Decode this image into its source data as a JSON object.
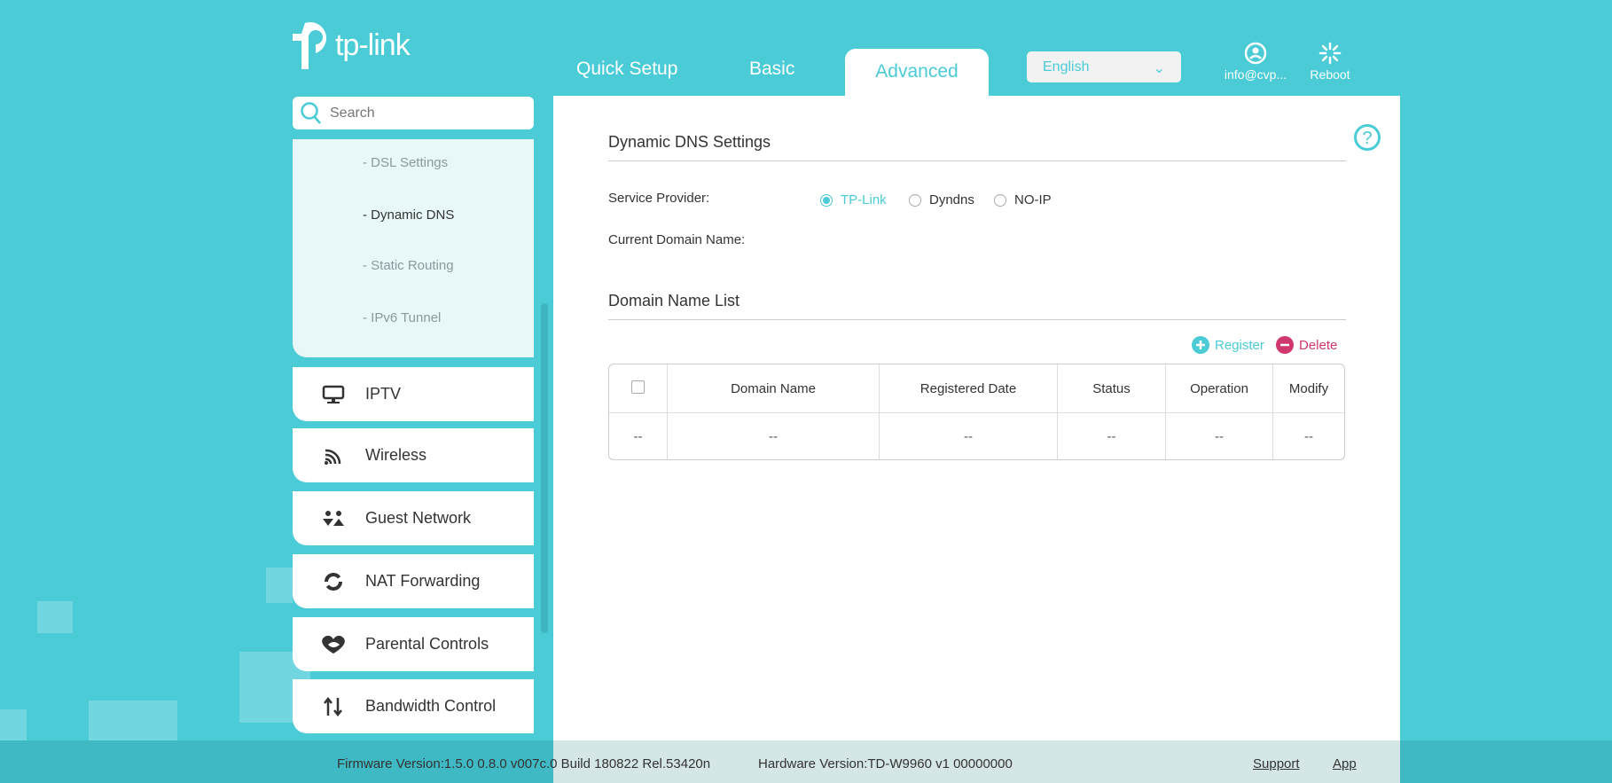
{
  "brand": {
    "logo_text": "tp-link"
  },
  "tabs": [
    {
      "label": "Quick Setup"
    },
    {
      "label": "Basic"
    },
    {
      "label": "Advanced"
    }
  ],
  "language": {
    "selected": "English"
  },
  "account": {
    "label": "info@cvp..."
  },
  "reboot": {
    "label": "Reboot"
  },
  "search": {
    "placeholder": "Search"
  },
  "submenu": [
    {
      "label": "- DSL Settings"
    },
    {
      "label": "- Dynamic DNS"
    },
    {
      "label": "- Static Routing"
    },
    {
      "label": "- IPv6 Tunnel"
    }
  ],
  "sidebar": [
    {
      "label": "IPTV",
      "icon": "monitor-icon"
    },
    {
      "label": "Wireless",
      "icon": "wireless-icon"
    },
    {
      "label": "Guest Network",
      "icon": "guest-icon"
    },
    {
      "label": "NAT Forwarding",
      "icon": "nat-icon"
    },
    {
      "label": "Parental Controls",
      "icon": "heart-icon"
    },
    {
      "label": "Bandwidth Control",
      "icon": "updown-icon"
    }
  ],
  "ddns": {
    "title": "Dynamic DNS Settings",
    "service_provider_label": "Service Provider:",
    "providers": [
      {
        "label": "TP-Link",
        "selected": true
      },
      {
        "label": "Dyndns",
        "selected": false
      },
      {
        "label": "NO-IP",
        "selected": false
      }
    ],
    "current_domain_label": "Current Domain Name:",
    "list_title": "Domain Name List",
    "register_label": "Register",
    "delete_label": "Delete",
    "columns": [
      "Domain Name",
      "Registered Date",
      "Status",
      "Operation",
      "Modify"
    ],
    "rows": [
      [
        "--",
        "--",
        "--",
        "--",
        "--",
        "--"
      ]
    ]
  },
  "footer": {
    "firmware": "Firmware Version:1.5.0 0.8.0 v007c.0 Build 180822 Rel.53420n",
    "hardware": "Hardware Version:TD-W9960 v1 00000000",
    "support": "Support",
    "app": "App"
  },
  "colors": {
    "accent": "#4acbd6",
    "delete": "#d0376f"
  }
}
